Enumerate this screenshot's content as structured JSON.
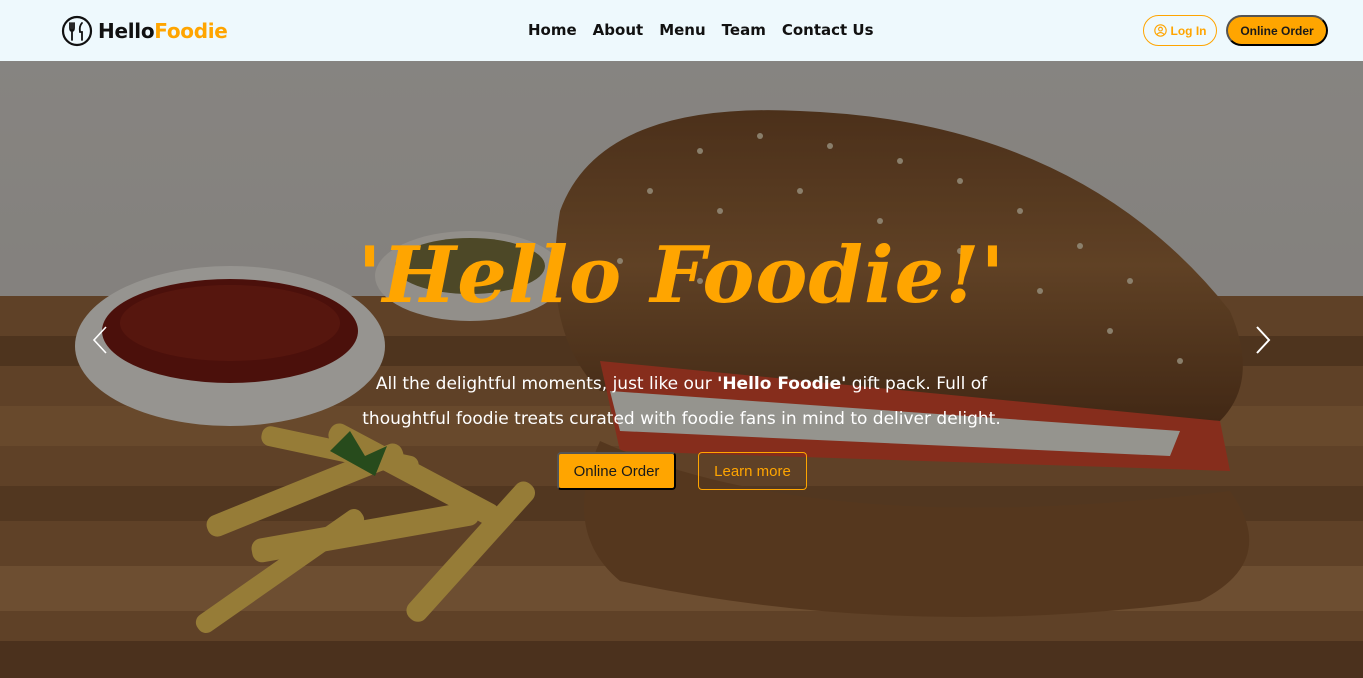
{
  "navbar": {
    "brand": {
      "part1": "Hello",
      "part2": "Foodie",
      "icon": "fork-knife-logo-icon"
    },
    "links": [
      {
        "label": "Home"
      },
      {
        "label": "About"
      },
      {
        "label": "Menu"
      },
      {
        "label": "Team"
      },
      {
        "label": "Contact Us"
      }
    ],
    "login_label": "Log In",
    "order_label": "Online Order"
  },
  "hero": {
    "title": "'Hello Foodie!'",
    "text_before": "All the delightful moments, just like our ",
    "text_bold": "'Hello Foodie'",
    "text_after": " gift pack. Full of thoughtful foodie treats curated with foodie fans in mind to deliver delight.",
    "primary_button": "Online Order",
    "secondary_button": "Learn more",
    "prev_icon": "chevron-left-icon",
    "next_icon": "chevron-right-icon"
  },
  "colors": {
    "accent": "#ffa500",
    "navbar_bg": "#eef9fd",
    "text_dark": "#111111"
  }
}
